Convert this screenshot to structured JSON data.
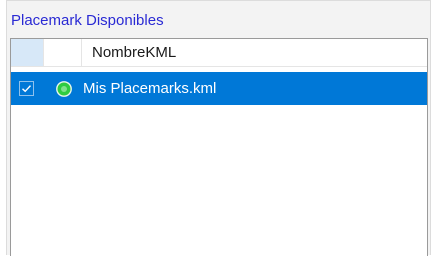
{
  "group": {
    "title": "Placemark Disponibles"
  },
  "listview": {
    "columns": [
      "",
      "",
      "NombreKML"
    ],
    "rows": [
      {
        "checked": true,
        "icon": "green-placemark-icon",
        "name": "Mis Placemarks.kml",
        "selected": true
      }
    ]
  },
  "colors": {
    "selection": "#0078d7",
    "title": "#2a2ad4",
    "icon_green": "#2ecc40"
  }
}
